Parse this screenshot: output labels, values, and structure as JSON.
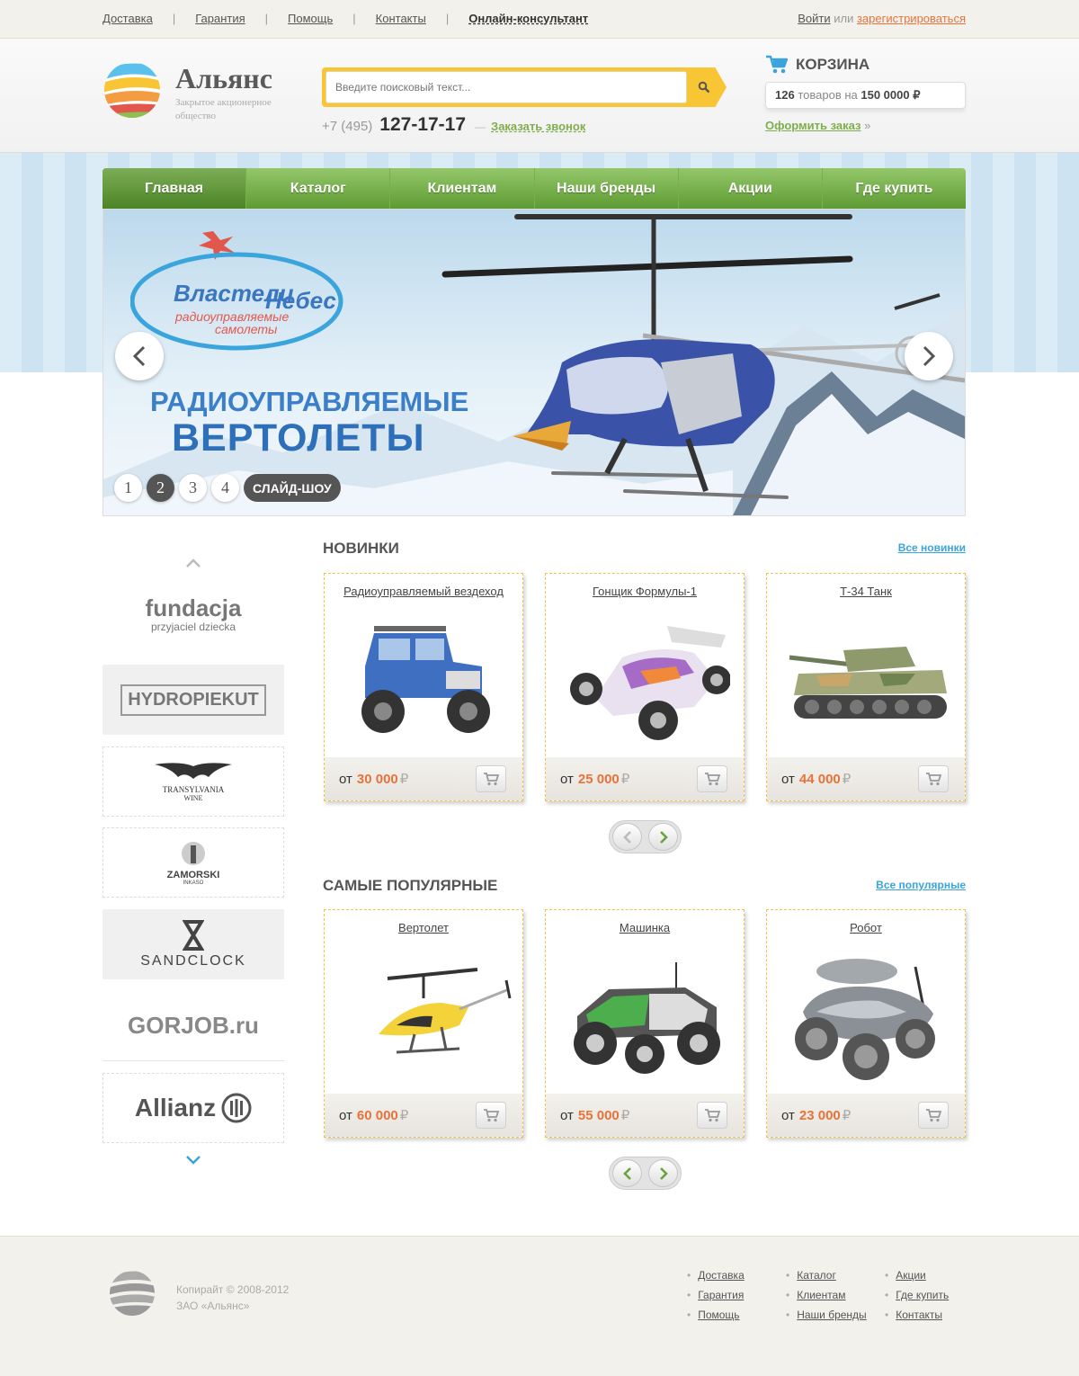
{
  "topbar": {
    "links": [
      "Доставка",
      "Гарантия",
      "Помощь",
      "Контакты"
    ],
    "consultant": "Онлайн-консультант",
    "login": "Войти",
    "or": "или",
    "register": "зарегистрироваться"
  },
  "header": {
    "logo_title": "Альянс",
    "logo_subtitle": "Закрытое акционерное общество",
    "search_placeholder": "Введите поисковый текст...",
    "phone_prefix": "+7 (495)",
    "phone_number": "127-17-17",
    "phone_dash": "—",
    "callback": "Заказать звонок",
    "cart_title": "КОРЗИНА",
    "cart_count": "126",
    "cart_count_text": "товаров на",
    "cart_sum": "150 0000",
    "cart_currency": "₽",
    "checkout": "Оформить заказ",
    "checkout_arrow": "»"
  },
  "nav": {
    "tabs": [
      "Главная",
      "Каталог",
      "Клиентам",
      "Наши бренды",
      "Акции",
      "Где купить"
    ],
    "active_index": 0
  },
  "slider": {
    "brand_line1": "Властели",
    "brand_line2": "Небес",
    "brand_sub1": "радиоуправляемые",
    "brand_sub2": "самолеты",
    "title1": "РАДИОУПРАВЛЯЕМЫЕ",
    "title2": "ВЕРТОЛЕТЫ",
    "pages": [
      "1",
      "2",
      "3",
      "4"
    ],
    "active_page": 1,
    "slideshow": "СЛАЙД-ШОУ"
  },
  "brands": {
    "items": [
      {
        "name": "fundacja",
        "sub": "przyjaciel dziecka"
      },
      {
        "name": "HYDROPIEKUT",
        "sub": ""
      },
      {
        "name": "TRANSYLVANIA",
        "sub": "WINE"
      },
      {
        "name": "ZAMORSKI",
        "sub": "INKASO"
      },
      {
        "name": "SANDCLOCK",
        "sub": ""
      },
      {
        "name": "GORJOB.ru",
        "sub": ""
      },
      {
        "name": "Allianz",
        "sub": ""
      }
    ]
  },
  "new_section": {
    "title": "НОВИНКИ",
    "link": "Все новинки",
    "products": [
      {
        "name": "Радиоуправляемый вездеход",
        "price_prefix": "от",
        "price": "30 000",
        "currency": "₽",
        "icon": "jeep-image"
      },
      {
        "name": "Гонщик Формулы-1",
        "price_prefix": "от",
        "price": "25 000",
        "currency": "₽",
        "icon": "buggy-image"
      },
      {
        "name": "Т-34 Танк",
        "price_prefix": "от",
        "price": "44 000",
        "currency": "₽",
        "icon": "tank-image"
      }
    ]
  },
  "popular_section": {
    "title": "САМЫЕ ПОПУЛЯРНЫЕ",
    "link": "Все популярные",
    "products": [
      {
        "name": "Вертолет",
        "price_prefix": "от",
        "price": "60 000",
        "currency": "₽",
        "icon": "helicopter-image"
      },
      {
        "name": "Машинка",
        "price_prefix": "от",
        "price": "55 000",
        "currency": "₽",
        "icon": "truck-image"
      },
      {
        "name": "Робот",
        "price_prefix": "от",
        "price": "23 000",
        "currency": "₽",
        "icon": "robot-image"
      }
    ]
  },
  "footer": {
    "copyright": "Копирайт © 2008-2012",
    "company": "ЗАО «Альянс»",
    "col1": [
      "Доставка",
      "Гарантия",
      "Помощь"
    ],
    "col2": [
      "Каталог",
      "Клиентам",
      "Наши бренды"
    ],
    "col3": [
      "Акции",
      "Где купить",
      "Контакты"
    ],
    "bullet": "•"
  },
  "colors": {
    "accent_orange": "#e8733a",
    "accent_green": "#7fae4e",
    "accent_yellow": "#f8c534",
    "link_blue": "#3aa4dc"
  }
}
